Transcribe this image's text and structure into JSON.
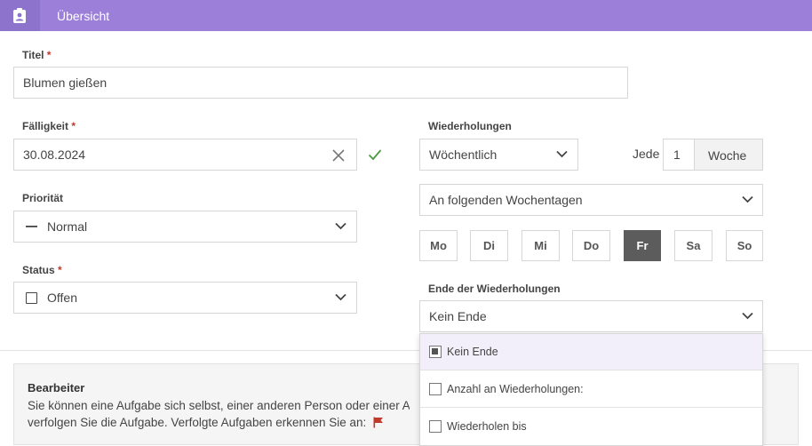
{
  "header": {
    "title": "Übersicht",
    "icon": "clipboard-account-icon"
  },
  "form": {
    "title_label": "Titel",
    "title_value": "Blumen gießen",
    "due_label": "Fälligkeit",
    "due_value": "30.08.2024",
    "priority_label": "Priorität",
    "priority_value": "Normal",
    "status_label": "Status",
    "status_value": "Offen",
    "required_mark": "*"
  },
  "recurrence": {
    "label": "Wiederholungen",
    "frequency_value": "Wöchentlich",
    "every_label": "Jede",
    "every_value": "1",
    "unit_label": "Woche",
    "mode_value": "An folgenden Wochentagen",
    "days": [
      {
        "label": "Mo",
        "active": false
      },
      {
        "label": "Di",
        "active": false
      },
      {
        "label": "Mi",
        "active": false
      },
      {
        "label": "Do",
        "active": false
      },
      {
        "label": "Fr",
        "active": true
      },
      {
        "label": "Sa",
        "active": false
      },
      {
        "label": "So",
        "active": false
      }
    ],
    "end_label": "Ende der Wiederholungen",
    "end_value": "Kein Ende",
    "end_options": [
      {
        "label": "Kein Ende",
        "selected": true
      },
      {
        "label": "Anzahl an Wiederholungen:",
        "selected": false
      },
      {
        "label": "Wiederholen bis",
        "selected": false
      }
    ]
  },
  "assignee": {
    "title": "Bearbeiter",
    "line1": "Sie können eine Aufgabe sich selbst, einer anderen Person oder einer A",
    "line2": "verfolgen Sie die Aufgabe. Verfolgte Aufgaben erkennen Sie an:"
  },
  "colors": {
    "header": "#9b7fd8",
    "accent_check": "#4a9a3f",
    "flag": "#c0392b",
    "active_day": "#5c5c5c"
  }
}
